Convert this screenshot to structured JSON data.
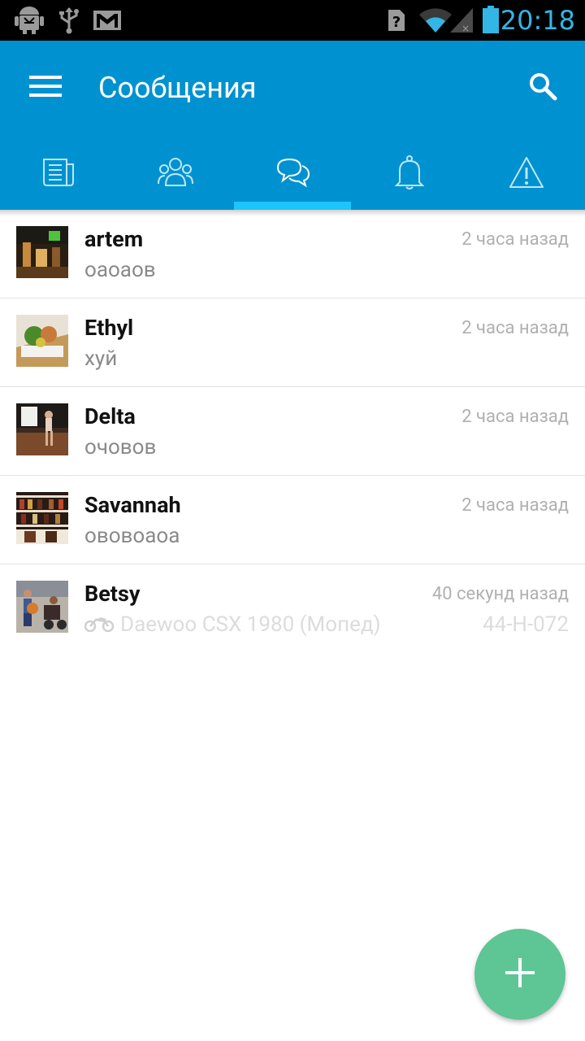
{
  "status_bar": {
    "time": "20:18",
    "icons": [
      "android-debug-icon",
      "usb-icon",
      "gmail-icon",
      "sim-unknown-icon",
      "wifi-icon",
      "signal-icon",
      "battery-icon"
    ]
  },
  "app_bar": {
    "title": "Сообщения",
    "menu_icon": "hamburger-menu-icon",
    "search_icon": "search-icon",
    "color": "#0092d0"
  },
  "tabs": [
    {
      "icon": "news-icon",
      "active": false
    },
    {
      "icon": "people-icon",
      "active": false
    },
    {
      "icon": "chat-bubbles-icon",
      "active": true
    },
    {
      "icon": "bell-icon",
      "active": false
    },
    {
      "icon": "warning-icon",
      "active": false
    }
  ],
  "conversations": [
    {
      "name": "artem",
      "message": "оаоаов",
      "time": "2 часа назад"
    },
    {
      "name": "Ethyl",
      "message": "хуй",
      "time": "2 часа назад"
    },
    {
      "name": "Delta",
      "message": "очовов",
      "time": "2 часа назад"
    },
    {
      "name": "Savannah",
      "message": "ововоаоа",
      "time": "2 часа назад"
    },
    {
      "name": "Betsy",
      "time": "40 секунд назад",
      "vehicle": "Daewoo CSX 1980 (Мопед)",
      "plate": "44-H-072",
      "vehicle_icon": "motorcycle-icon"
    }
  ],
  "fab": {
    "icon": "plus-icon",
    "color": "#5ec595"
  }
}
